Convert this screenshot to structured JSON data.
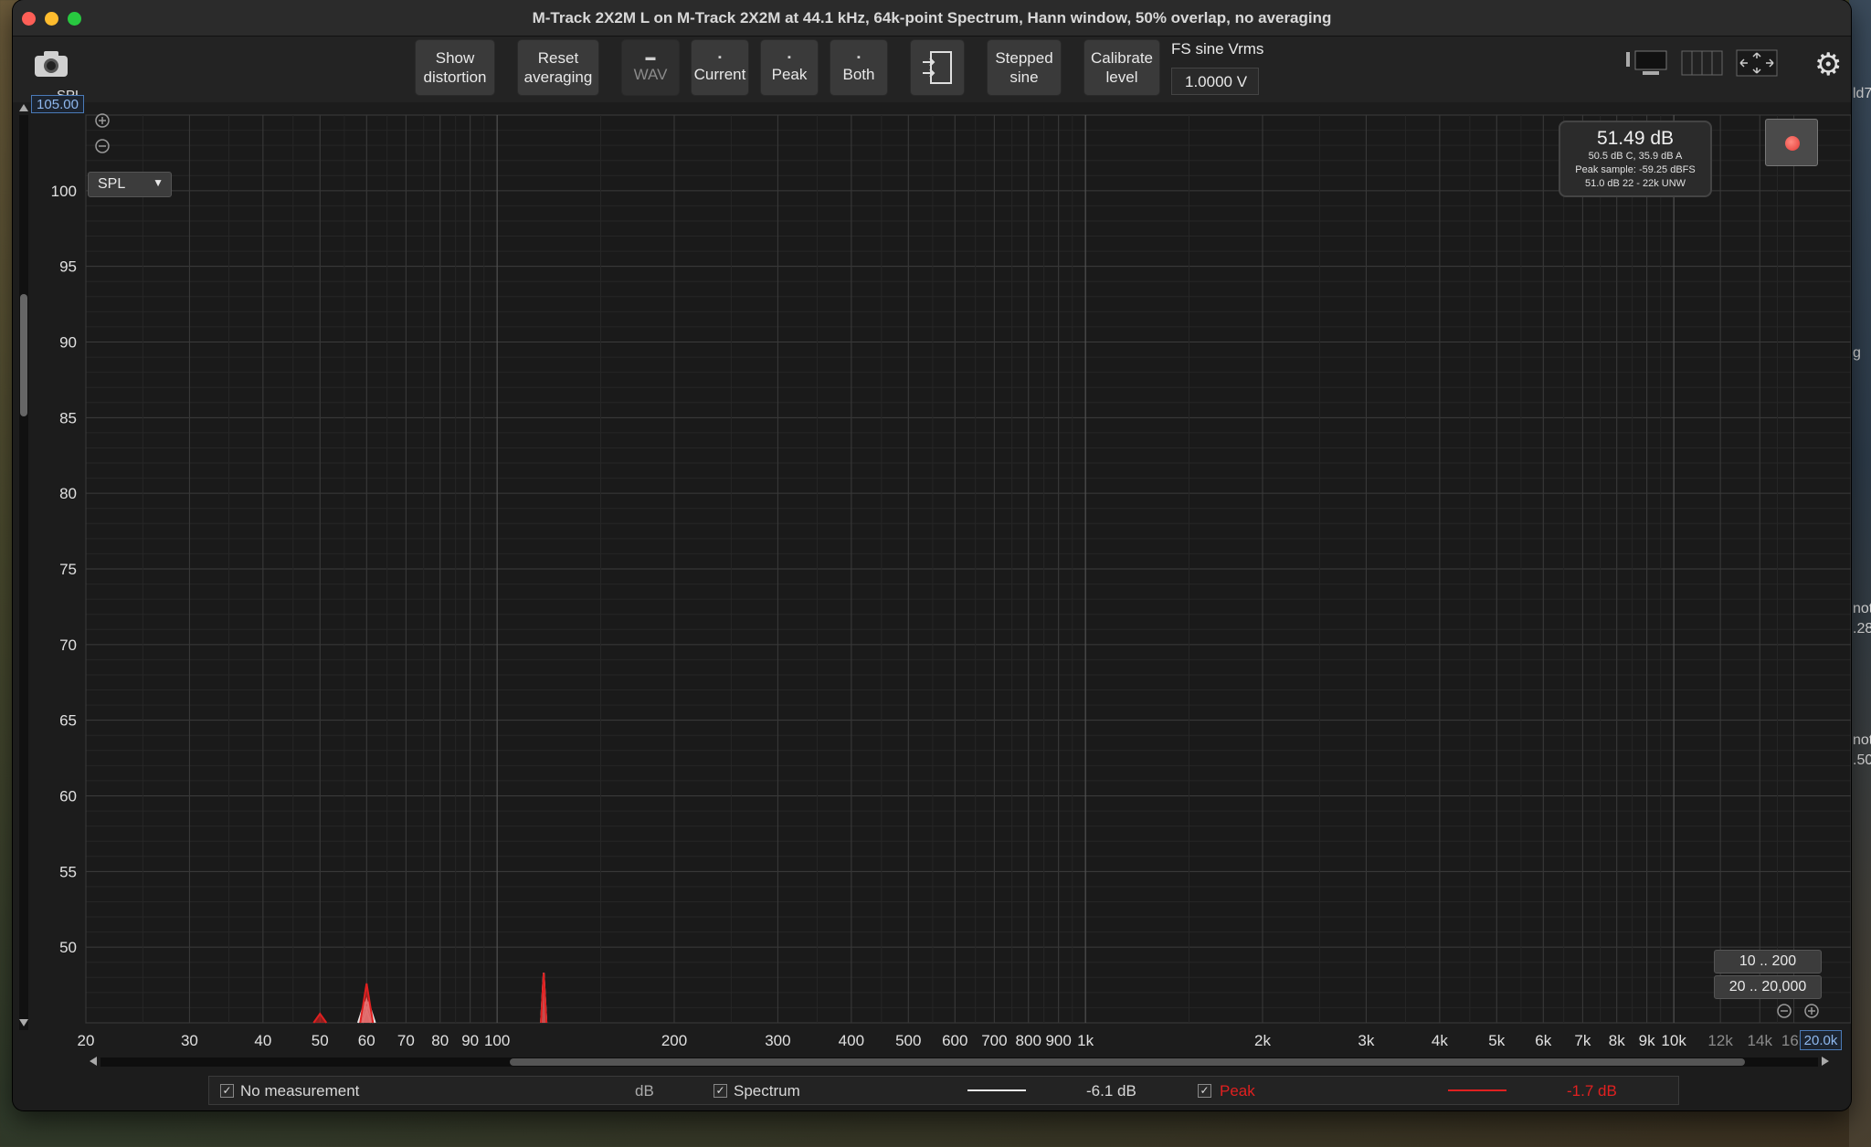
{
  "window": {
    "title": "M-Track 2X2M  L on M-Track 2X2M at 44.1 kHz, 64k-point Spectrum, Hann window, 50% overlap, no averaging"
  },
  "toolbar": {
    "show_distortion": [
      "Show",
      "distortion"
    ],
    "reset_averaging": [
      "Reset",
      "averaging"
    ],
    "wav": "WAV",
    "current": "Current",
    "peak": "Peak",
    "both": "Both",
    "stepped_sine": [
      "Stepped",
      "sine"
    ],
    "calibrate_level": [
      "Calibrate",
      "level"
    ],
    "fs_label": "FS sine Vrms",
    "fs_value": "1.0000 V"
  },
  "plot": {
    "y_unit_label": "SPL",
    "y_max_box": "105.00",
    "x_max_box": "20.0k",
    "spl_dropdown": "SPL",
    "range_10_200": "10 .. 200",
    "range_20_20000": "20 .. 20,000",
    "readout_main": "51.49 dB",
    "readout_line1": "50.5 dB C, 35.9 dB A",
    "readout_line2": "Peak sample: -59.25 dBFS",
    "readout_line3": "51.0 dB 22 - 22k UNW"
  },
  "legend": {
    "no_measurement": "No measurement",
    "db_unit": "dB",
    "spectrum": "Spectrum",
    "spectrum_level": "-6.1 dB",
    "peak": "Peak",
    "peak_level": "-1.7 dB"
  },
  "colors": {
    "spectrum_line": "#e8e8e8",
    "peak_line": "#e02020",
    "readout_box_border": "#4a7ab8"
  },
  "chart_data": {
    "type": "line",
    "xscale": "log",
    "xlim": [
      20,
      20000
    ],
    "ylim": [
      45,
      105
    ],
    "x_ticks": [
      20,
      30,
      40,
      50,
      60,
      70,
      80,
      90,
      100,
      200,
      300,
      400,
      500,
      600,
      700,
      800,
      900,
      1000,
      2000,
      3000,
      4000,
      5000,
      6000,
      7000,
      8000,
      9000,
      10000,
      12000,
      14000,
      16000,
      20000
    ],
    "x_tick_labels": [
      "20",
      "30",
      "40",
      "50",
      "60",
      "70",
      "80",
      "90",
      "100",
      "200",
      "300",
      "400",
      "500",
      "600",
      "700",
      "800",
      "900",
      "1k",
      "2k",
      "3k",
      "4k",
      "5k",
      "6k",
      "7k",
      "8k",
      "9k",
      "10k",
      "12k",
      "14k",
      "16k",
      "20.0k"
    ],
    "y_ticks": [
      50,
      55,
      60,
      65,
      70,
      75,
      80,
      85,
      90,
      95,
      100
    ],
    "y_tick_labels": [
      "50",
      "55",
      "60",
      "65",
      "70",
      "75",
      "80",
      "85",
      "90",
      "95",
      "100"
    ],
    "grid": true,
    "series": [
      {
        "name": "Spectrum",
        "color": "#e8e8e8",
        "points": [
          [
            59.5,
            46.3
          ],
          [
            60,
            46.5
          ],
          [
            60.5,
            46.3
          ],
          [
            120,
            48.3
          ]
        ]
      },
      {
        "name": "Peak",
        "color": "#e02020",
        "points": [
          [
            50,
            45.6
          ],
          [
            60,
            47.6
          ],
          [
            120,
            48.3
          ]
        ]
      }
    ]
  }
}
